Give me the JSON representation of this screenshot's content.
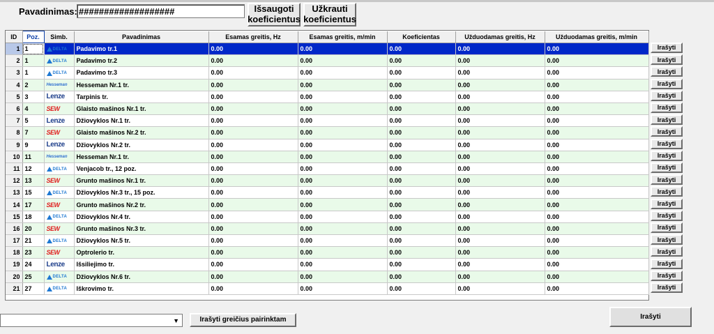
{
  "header": {
    "name_label": "Pavadinimas:",
    "name_value": "###################",
    "save_button": "Išsaugoti koeficientus",
    "load_button": "Užkrauti koeficientus"
  },
  "table": {
    "columns": [
      "ID",
      "Poz.",
      "Simb.",
      "Pavadinimas",
      "Esamas greitis, Hz",
      "Esamas greitis, m/min",
      "Koeficientas",
      "Užduodamas greitis, Hz",
      "Užduodamas greitis, m/min"
    ],
    "rows": [
      {
        "id": "1",
        "poz": "1",
        "logo": "delta-logo",
        "name": "Padavimo tr.1",
        "hz": "0.00",
        "mmin": "0.00",
        "coef": "0.00",
        "set_hz": "0.00",
        "set_mmin": "0.00"
      },
      {
        "id": "2",
        "poz": "1",
        "logo": "delta-logo",
        "name": "Padavimo tr.2",
        "hz": "0.00",
        "mmin": "0.00",
        "coef": "0.00",
        "set_hz": "0.00",
        "set_mmin": "0.00"
      },
      {
        "id": "3",
        "poz": "1",
        "logo": "delta-logo",
        "name": "Padavimo tr.3",
        "hz": "0.00",
        "mmin": "0.00",
        "coef": "0.00",
        "set_hz": "0.00",
        "set_mmin": "0.00"
      },
      {
        "id": "4",
        "poz": "2",
        "logo": "hesseman-logo",
        "name": "Hesseman Nr.1 tr.",
        "hz": "0.00",
        "mmin": "0.00",
        "coef": "0.00",
        "set_hz": "0.00",
        "set_mmin": "0.00"
      },
      {
        "id": "5",
        "poz": "3",
        "logo": "lenze-logo",
        "name": "Tarpinis tr.",
        "hz": "0.00",
        "mmin": "0.00",
        "coef": "0.00",
        "set_hz": "0.00",
        "set_mmin": "0.00"
      },
      {
        "id": "6",
        "poz": "4",
        "logo": "sew-logo",
        "name": "Glaisto mašinos Nr.1 tr.",
        "hz": "0.00",
        "mmin": "0.00",
        "coef": "0.00",
        "set_hz": "0.00",
        "set_mmin": "0.00"
      },
      {
        "id": "7",
        "poz": "5",
        "logo": "lenze-logo",
        "name": "Džiovyklos Nr.1 tr.",
        "hz": "0.00",
        "mmin": "0.00",
        "coef": "0.00",
        "set_hz": "0.00",
        "set_mmin": "0.00"
      },
      {
        "id": "8",
        "poz": "7",
        "logo": "sew-logo",
        "name": "Glaisto mašinos Nr.2 tr.",
        "hz": "0.00",
        "mmin": "0.00",
        "coef": "0.00",
        "set_hz": "0.00",
        "set_mmin": "0.00"
      },
      {
        "id": "9",
        "poz": "9",
        "logo": "lenze-logo",
        "name": "Džiovyklos Nr.2 tr.",
        "hz": "0.00",
        "mmin": "0.00",
        "coef": "0.00",
        "set_hz": "0.00",
        "set_mmin": "0.00"
      },
      {
        "id": "10",
        "poz": "11",
        "logo": "hesseman-logo",
        "name": "Hesseman Nr.1 tr.",
        "hz": "0.00",
        "mmin": "0.00",
        "coef": "0.00",
        "set_hz": "0.00",
        "set_mmin": "0.00"
      },
      {
        "id": "11",
        "poz": "12",
        "logo": "delta-logo",
        "name": "Venjacob tr., 12 poz.",
        "hz": "0.00",
        "mmin": "0.00",
        "coef": "0.00",
        "set_hz": "0.00",
        "set_mmin": "0.00"
      },
      {
        "id": "12",
        "poz": "13",
        "logo": "sew-logo",
        "name": "Grunto mašinos Nr.1 tr.",
        "hz": "0.00",
        "mmin": "0.00",
        "coef": "0.00",
        "set_hz": "0.00",
        "set_mmin": "0.00"
      },
      {
        "id": "13",
        "poz": "15",
        "logo": "delta-logo",
        "name": "Džiovyklos Nr.3 tr., 15 poz.",
        "hz": "0.00",
        "mmin": "0.00",
        "coef": "0.00",
        "set_hz": "0.00",
        "set_mmin": "0.00"
      },
      {
        "id": "14",
        "poz": "17",
        "logo": "sew-logo",
        "name": "Grunto mašinos Nr.2 tr.",
        "hz": "0.00",
        "mmin": "0.00",
        "coef": "0.00",
        "set_hz": "0.00",
        "set_mmin": "0.00"
      },
      {
        "id": "15",
        "poz": "18",
        "logo": "delta-logo",
        "name": "Džiovyklos Nr.4 tr.",
        "hz": "0.00",
        "mmin": "0.00",
        "coef": "0.00",
        "set_hz": "0.00",
        "set_mmin": "0.00"
      },
      {
        "id": "16",
        "poz": "20",
        "logo": "sew-logo",
        "name": "Grunto mašinos Nr.3 tr.",
        "hz": "0.00",
        "mmin": "0.00",
        "coef": "0.00",
        "set_hz": "0.00",
        "set_mmin": "0.00"
      },
      {
        "id": "17",
        "poz": "21",
        "logo": "delta-logo",
        "name": "Džiovyklos Nr.5 tr.",
        "hz": "0.00",
        "mmin": "0.00",
        "coef": "0.00",
        "set_hz": "0.00",
        "set_mmin": "0.00"
      },
      {
        "id": "18",
        "poz": "23",
        "logo": "sew-logo",
        "name": "Optrolerio tr.",
        "hz": "0.00",
        "mmin": "0.00",
        "coef": "0.00",
        "set_hz": "0.00",
        "set_mmin": "0.00"
      },
      {
        "id": "19",
        "poz": "24",
        "logo": "lenze-logo",
        "name": "Išsiliejimo tr.",
        "hz": "0.00",
        "mmin": "0.00",
        "coef": "0.00",
        "set_hz": "0.00",
        "set_mmin": "0.00"
      },
      {
        "id": "20",
        "poz": "25",
        "logo": "delta-logo",
        "name": "Džiovyklos Nr.6 tr.",
        "hz": "0.00",
        "mmin": "0.00",
        "coef": "0.00",
        "set_hz": "0.00",
        "set_mmin": "0.00"
      },
      {
        "id": "21",
        "poz": "27",
        "logo": "delta-logo",
        "name": "Iškrovimo tr.",
        "hz": "0.00",
        "mmin": "0.00",
        "coef": "0.00",
        "set_hz": "0.00",
        "set_mmin": "0.00"
      }
    ],
    "selected_row": 1,
    "row_button_label": "Irašyti"
  },
  "logos": {
    "delta_text": "DELTA",
    "lenze_text": "Lenze",
    "sew_text": "SEW",
    "hesseman_text": "Hesseman"
  },
  "footer": {
    "select_value": "",
    "write_selected_button": "Irašyti greičius pairinktam",
    "write_button": "Irašyti"
  },
  "colors": {
    "selection": "#0028c8",
    "row_alt": "#e9fae9",
    "header_accent": "#0b3ea8"
  }
}
